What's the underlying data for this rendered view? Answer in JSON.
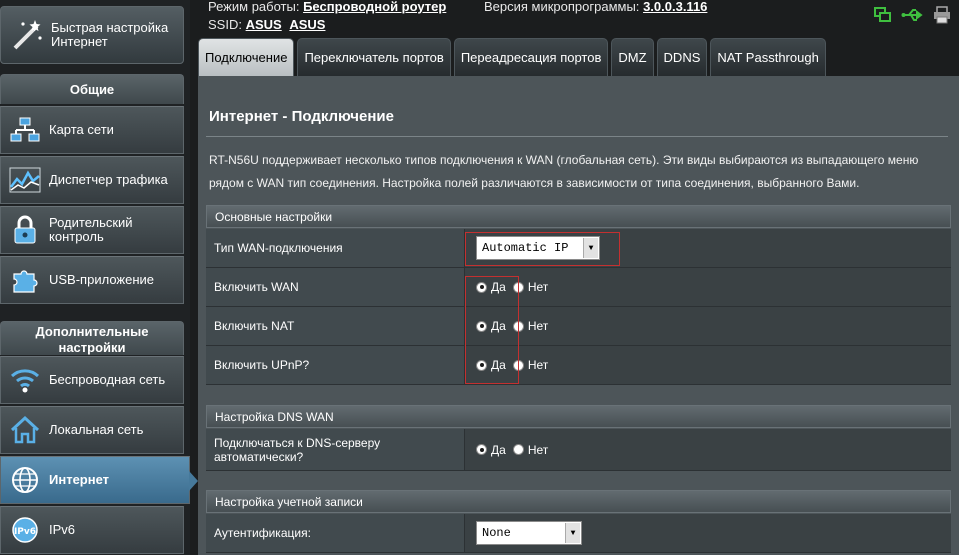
{
  "sidebar": {
    "quick_setup": "Быстрая настройка Интернет",
    "general_header": "Общие",
    "general_items": [
      {
        "label": "Карта сети",
        "icon": "network-map-icon"
      },
      {
        "label": "Диспетчер трафика",
        "icon": "traffic-manager-icon"
      },
      {
        "label": "Родительский контроль",
        "icon": "parental-lock-icon"
      },
      {
        "label": "USB-приложение",
        "icon": "usb-app-puzzle-icon"
      }
    ],
    "advanced_header": "Дополнительные настройки",
    "advanced_items": [
      {
        "label": "Беспроводная сеть",
        "icon": "wireless-icon"
      },
      {
        "label": "Локальная сеть",
        "icon": "home-lan-icon"
      },
      {
        "label": "Интернет",
        "icon": "globe-icon",
        "active": true
      },
      {
        "label": "IPv6",
        "icon": "ipv6-icon"
      }
    ]
  },
  "status": {
    "mode_label": "Режим работы:",
    "mode_value": "Беспроводной роутер",
    "firmware_label": "Версия микропрограммы:",
    "firmware_value": "3.0.0.3.116",
    "ssid_label": "SSID:",
    "ssid_values": [
      "ASUS",
      "ASUS"
    ]
  },
  "tabs": [
    "Подключение",
    "Переключатель портов",
    "Переадресация портов",
    "DMZ",
    "DDNS",
    "NAT Passthrough"
  ],
  "page": {
    "title": "Интернет - Подключение",
    "description": "RT-N56U поддерживает несколько типов подключения к WAN (глобальная сеть). Эти виды выбираются из выпадающего меню рядом с WAN тип соединения. Настройка полей различаются в зависимости от типа соединения, выбранного Вами."
  },
  "basic": {
    "header": "Основные настройки",
    "wan_type_label": "Тип WAN-подключения",
    "wan_type_value": "Automatic IP",
    "enable_wan_label": "Включить WAN",
    "enable_nat_label": "Включить NAT",
    "enable_upnp_label": "Включить UPnP?"
  },
  "dns": {
    "header": "Настройка DNS WAN",
    "auto_dns_label": "Подключаться к DNS-серверу автоматически?"
  },
  "account": {
    "header": "Настройка учетной записи",
    "auth_label": "Аутентификация:",
    "auth_value": "None"
  },
  "radio": {
    "yes": "Да",
    "no": "Нет"
  },
  "colors": {
    "active_nav": "#46799b",
    "highlight": "#c43030",
    "status_green": "#3fbf3f"
  }
}
